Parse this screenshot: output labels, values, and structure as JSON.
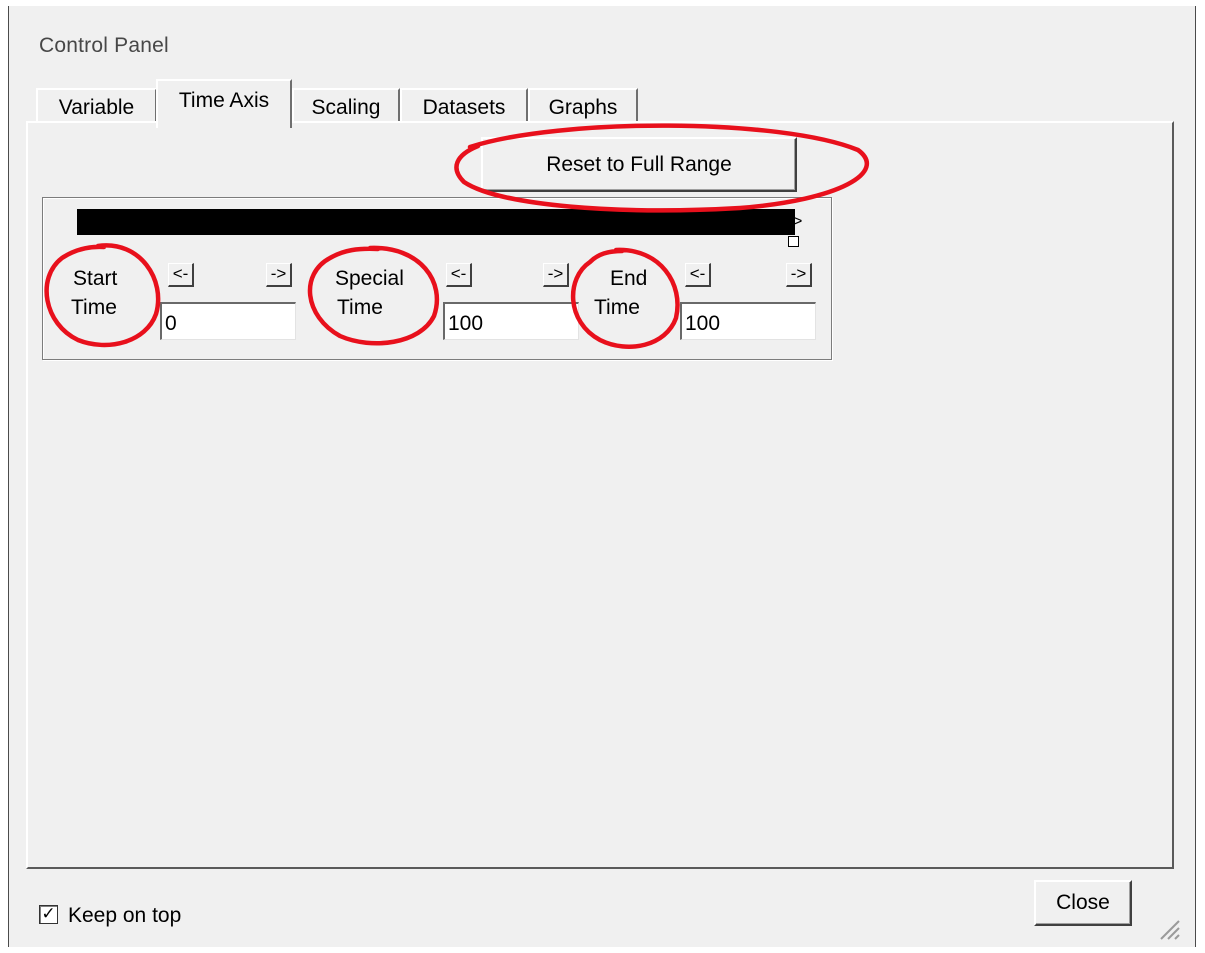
{
  "window": {
    "title": "Control Panel"
  },
  "tabs": [
    {
      "label": "Variable",
      "active": false
    },
    {
      "label": "Time Axis",
      "active": true
    },
    {
      "label": "Scaling",
      "active": false
    },
    {
      "label": "Datasets",
      "active": false
    },
    {
      "label": "Graphs",
      "active": false
    }
  ],
  "time_axis": {
    "reset_button_label": "Reset to Full Range",
    "slider_arrow": ">",
    "start": {
      "label_line1": "Start",
      "label_line2": "Time",
      "prev_label": "<-",
      "next_label": "->",
      "value": "0"
    },
    "special": {
      "label_line1": "Special",
      "label_line2": "Time",
      "prev_label": "<-",
      "next_label": "->",
      "value": "100"
    },
    "end": {
      "label_line1": "End",
      "label_line2": "Time",
      "prev_label": "<-",
      "next_label": "->",
      "value": "100"
    }
  },
  "footer": {
    "keep_on_top_label": "Keep on top",
    "keep_on_top_checked": true,
    "checkmark": "✓",
    "close_label": "Close"
  },
  "annotations": {
    "color": "#e8101c"
  }
}
